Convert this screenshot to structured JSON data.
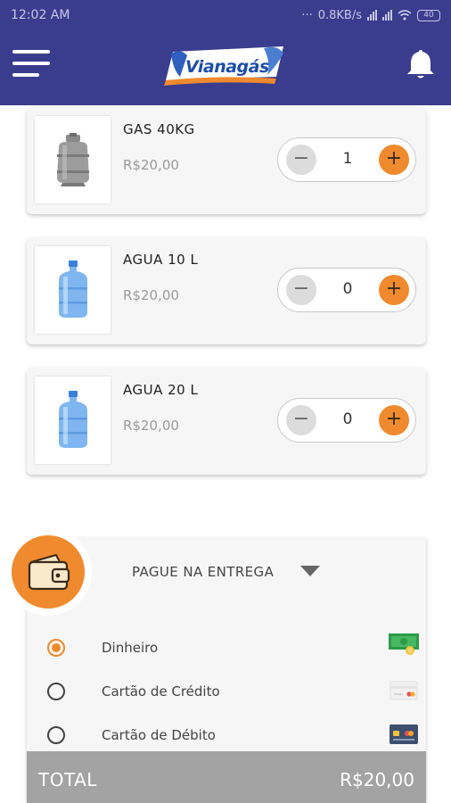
{
  "status_bar": {
    "time": "12:02 AM",
    "speed": "0.8KB/s",
    "battery": "40"
  },
  "header": {
    "brand": "Vianagás"
  },
  "products": [
    {
      "name": "GAS 40KG",
      "price": "R$20,00",
      "quantity": "1",
      "image": "gas-cylinder-icon"
    },
    {
      "name": "AGUA 10 L",
      "price": "R$20,00",
      "quantity": "0",
      "image": "water-jug-icon"
    },
    {
      "name": "AGUA 20 L",
      "price": "R$20,00",
      "quantity": "0",
      "image": "water-jug-icon"
    }
  ],
  "stepper": {
    "minus": "−",
    "plus": "+"
  },
  "payment": {
    "title": "PAGUE NA ENTREGA",
    "options": [
      {
        "label": "Dinheiro",
        "selected": true,
        "icon": "cash-icon"
      },
      {
        "label": "Cartão de Crédito",
        "selected": false,
        "icon": "credit-card-icon"
      },
      {
        "label": "Cartão de Débito",
        "selected": false,
        "icon": "debit-card-icon"
      }
    ]
  },
  "total": {
    "label": "TOTAL",
    "value": "R$20,00"
  },
  "colors": {
    "primary": "#3a3c8e",
    "accent": "#f08a2e",
    "total_bar": "#a3a3a3"
  }
}
